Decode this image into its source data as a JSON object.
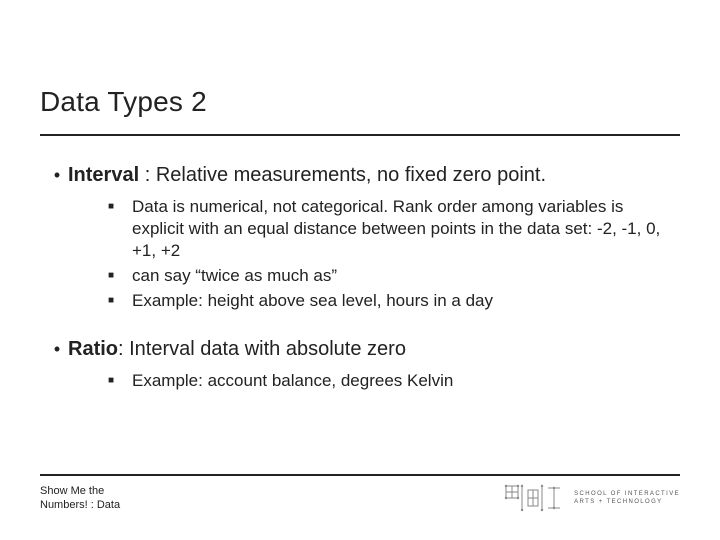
{
  "title": "Data Types 2",
  "items": [
    {
      "label": "Interval",
      "desc": " : Relative measurements, no fixed zero point.",
      "subs": [
        "Data is numerical, not categorical. Rank order among variables is explicit with an equal distance between points in the data set: -2, -1, 0, +1, +2",
        " can say “twice as much as”",
        "Example: height above sea level, hours in a day"
      ]
    },
    {
      "label": "Ratio",
      "desc": ": Interval data with absolute zero",
      "subs": [
        "Example: account balance, degrees Kelvin"
      ]
    }
  ],
  "footer": {
    "left": "Show Me the Numbers! : Data",
    "org_line1": "SCHOOL OF INTERACTIVE",
    "org_line2": "ARTS + TECHNOLOGY"
  }
}
